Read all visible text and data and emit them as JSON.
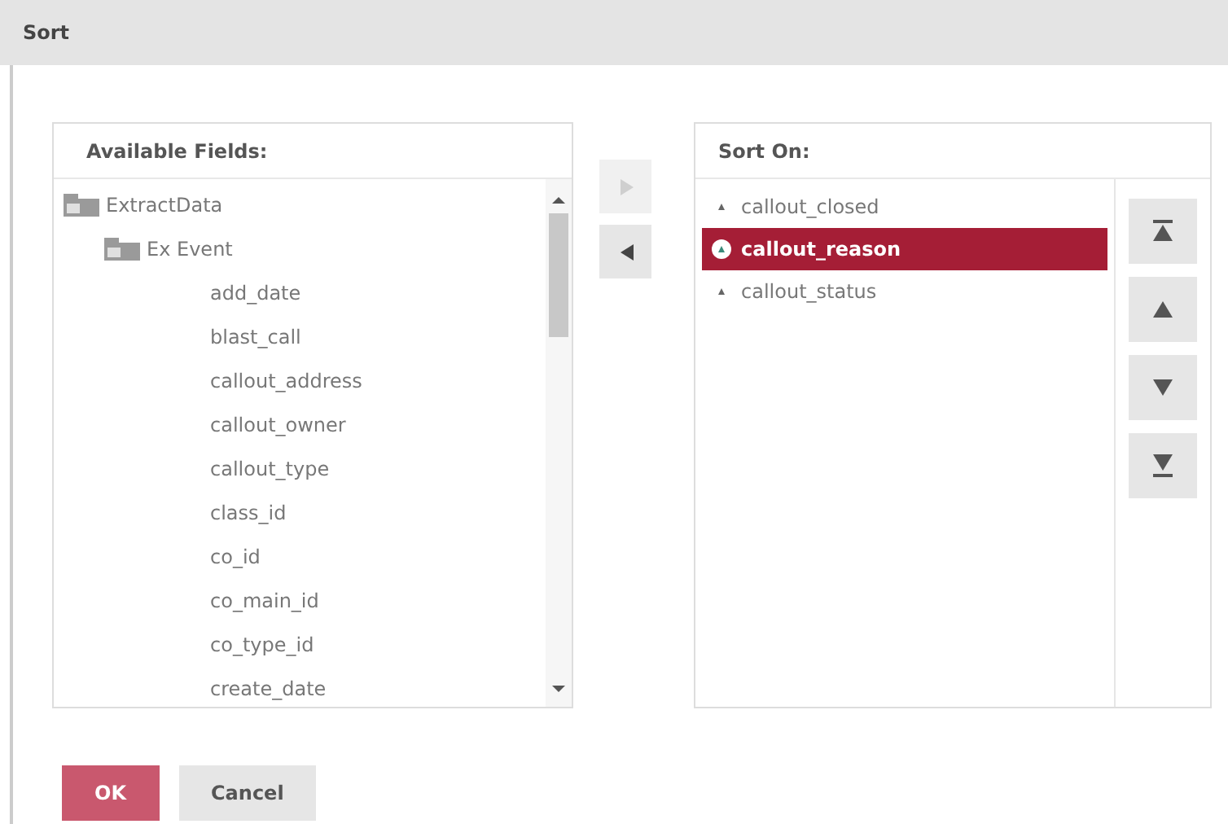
{
  "window": {
    "title": "Sort"
  },
  "available_fields": {
    "title": "Available Fields:",
    "tree": [
      {
        "label": "ExtractData",
        "kind": "folder",
        "children": [
          {
            "label": "Ex Event",
            "kind": "folder",
            "children": [
              {
                "label": "add_date",
                "kind": "field"
              },
              {
                "label": "blast_call",
                "kind": "field"
              },
              {
                "label": "callout_address",
                "kind": "field"
              },
              {
                "label": "callout_owner",
                "kind": "field"
              },
              {
                "label": "callout_type",
                "kind": "field"
              },
              {
                "label": "class_id",
                "kind": "field"
              },
              {
                "label": "co_id",
                "kind": "field"
              },
              {
                "label": "co_main_id",
                "kind": "field"
              },
              {
                "label": "co_type_id",
                "kind": "field"
              },
              {
                "label": "create_date",
                "kind": "field"
              }
            ]
          }
        ]
      }
    ]
  },
  "transfer_buttons": [
    {
      "kind": "add",
      "disabled": true
    },
    {
      "kind": "remove",
      "disabled": false
    }
  ],
  "sort_on": {
    "title": "Sort On:",
    "items": [
      {
        "label": "callout_closed",
        "ascending": true,
        "selected": false
      },
      {
        "label": "callout_reason",
        "ascending": true,
        "selected": true
      },
      {
        "label": "callout_status",
        "ascending": true,
        "selected": false
      }
    ]
  },
  "order_buttons": [
    {
      "kind": "top"
    },
    {
      "kind": "up"
    },
    {
      "kind": "down"
    },
    {
      "kind": "bottom"
    }
  ],
  "buttons": [
    {
      "label": "OK",
      "kind": "primary"
    },
    {
      "label": "Cancel",
      "kind": "secondary"
    }
  ]
}
